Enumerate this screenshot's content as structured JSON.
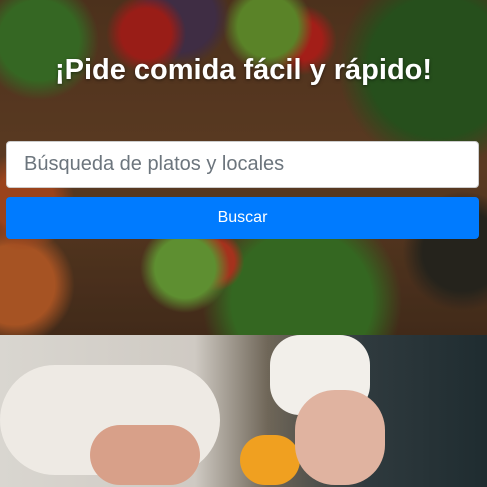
{
  "hero": {
    "title": "¡Pide comida fácil y rápido!",
    "search": {
      "placeholder": "Búsqueda de platos y locales",
      "value": ""
    },
    "search_button_label": "Buscar"
  },
  "colors": {
    "accent": "#007bff",
    "title_text": "#ffffff"
  }
}
